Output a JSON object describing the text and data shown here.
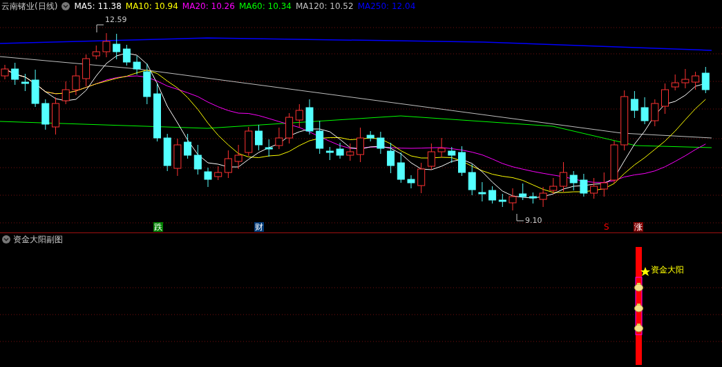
{
  "main_panel": {
    "title": "云南锗业(日线)",
    "indicators": [
      {
        "label": "MA5: 11.38",
        "color": "#ffffff"
      },
      {
        "label": "MA10: 10.94",
        "color": "#ffff00"
      },
      {
        "label": "MA20: 10.26",
        "color": "#ff00ff"
      },
      {
        "label": "MA60: 10.34",
        "color": "#00ff00"
      },
      {
        "label": "MA120: 10.52",
        "color": "#c0c0c0"
      },
      {
        "label": "MA250: 12.04",
        "color": "#0000ff"
      }
    ],
    "high_label": "12.59",
    "low_label": "9.10",
    "signals": [
      {
        "kind": "tag",
        "text": "跌",
        "color": "#008000"
      },
      {
        "kind": "tag",
        "text": "财",
        "color": "#003a78"
      },
      {
        "kind": "plain",
        "text": "S",
        "color": "#ff0000"
      },
      {
        "kind": "tag",
        "text": "涨",
        "color": "#800000"
      }
    ]
  },
  "sub_panel": {
    "title": "资金大阳副图",
    "signal_label": "资金大阳"
  }
}
